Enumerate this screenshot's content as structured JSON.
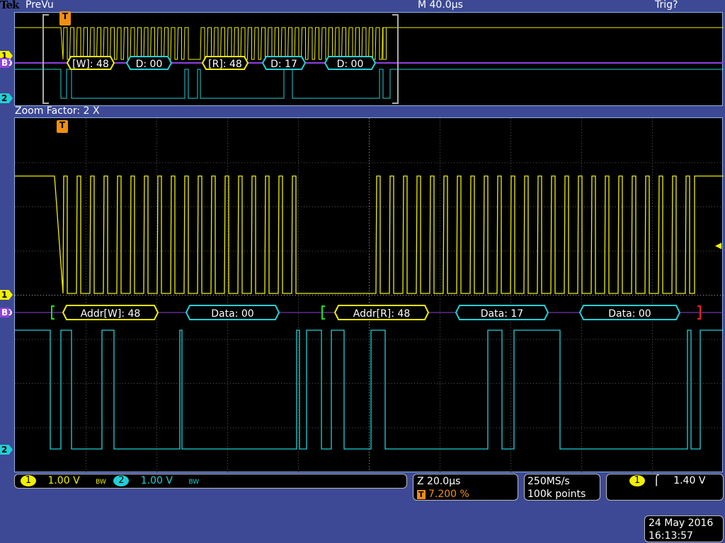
{
  "header": {
    "brand": "Tek",
    "mode": "PreVu",
    "timebase": "M 40.0µs",
    "trigger_state": "Trig?"
  },
  "zoom_factor": "Zoom Factor: 2 X",
  "markers": {
    "ch1": "1",
    "bus": "B1",
    "ch2": "2",
    "trigger": "T"
  },
  "overview_decode": [
    "[W]: 48",
    "D: 00",
    "[R]: 48",
    "D: 17",
    "D: 00"
  ],
  "main_decode": [
    "Addr[W]: 48",
    "Data: 00",
    "Addr[R]: 48",
    "Data: 17",
    "Data: 00"
  ],
  "status": {
    "ch1": {
      "num": "1",
      "scale": "1.00 V",
      "bw": "BW"
    },
    "ch2": {
      "num": "2",
      "scale": "1.00 V",
      "bw": "BW"
    },
    "zoom_time": "Z 20.0µs",
    "trigger_pos": "7.200 %",
    "trigger_icon": "T",
    "sample_rate": "250MS/s",
    "record_length": "100k points",
    "trigger_source": "1",
    "trigger_slope": "rising-edge-icon",
    "trigger_level": "1.40 V",
    "date": "24 May 2016",
    "time": "16:13:57"
  },
  "colors": {
    "ch1": "#f0f000",
    "ch2": "#20d0d8",
    "bus": "#9040e0",
    "trigger": "#f09010",
    "background": "#3d4994"
  }
}
